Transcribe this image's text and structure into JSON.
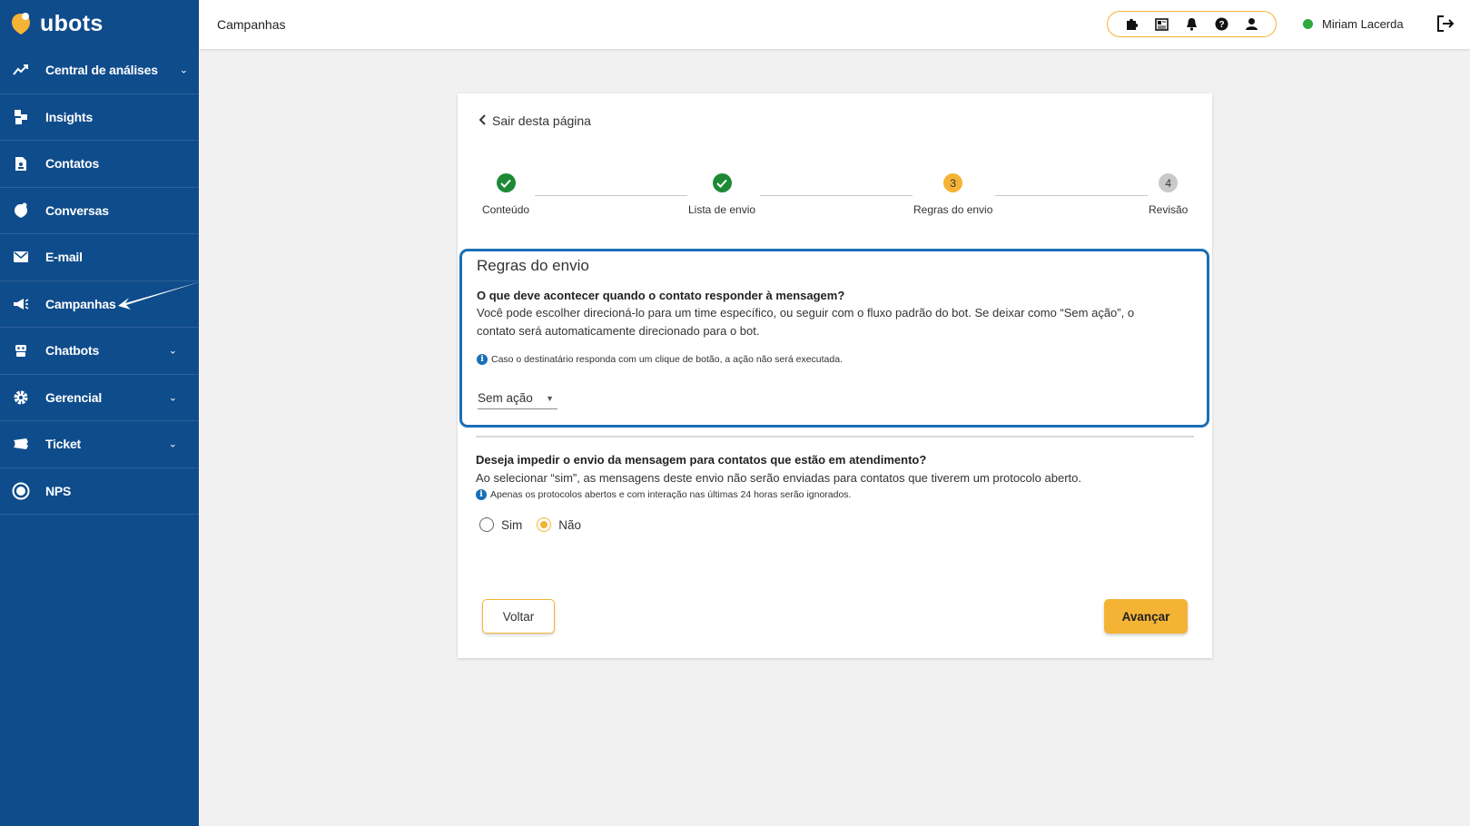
{
  "brand": {
    "name": "ubots",
    "accent": "#f5b335",
    "sidebar_bg": "#0f4c8c",
    "highlight": "#1a6fb5"
  },
  "sidebar": {
    "items": [
      {
        "label": "Central de análises",
        "icon": "chart-line-icon",
        "has_chevron": true
      },
      {
        "label": "Insights",
        "icon": "cubes-icon",
        "has_chevron": false
      },
      {
        "label": "Contatos",
        "icon": "contact-file-icon",
        "has_chevron": false
      },
      {
        "label": "Conversas",
        "icon": "chat-bubble-icon",
        "has_chevron": false
      },
      {
        "label": "E-mail",
        "icon": "envelope-icon",
        "has_chevron": false
      },
      {
        "label": "Campanhas",
        "icon": "megaphone-icon",
        "has_chevron": false
      },
      {
        "label": "Chatbots",
        "icon": "robot-icon",
        "has_chevron": true
      },
      {
        "label": "Gerencial",
        "icon": "gear-icon",
        "has_chevron": true
      },
      {
        "label": "Ticket",
        "icon": "ticket-icon",
        "has_chevron": true
      },
      {
        "label": "NPS",
        "icon": "nps-icon",
        "has_chevron": false
      }
    ]
  },
  "header": {
    "title": "Campanhas",
    "tools": [
      "puzzle-icon",
      "news-icon",
      "bell-icon",
      "help-icon",
      "user-icon"
    ],
    "user_name": "Miriam Lacerda",
    "status_color": "#2eaa3a"
  },
  "card": {
    "back_label": "Sair desta página",
    "steps": [
      {
        "label": "Conteúdo",
        "state": "done",
        "number": ""
      },
      {
        "label": "Lista de envio",
        "state": "done",
        "number": ""
      },
      {
        "label": "Regras do envio",
        "state": "active",
        "number": "3"
      },
      {
        "label": "Revisão",
        "state": "todo",
        "number": "4"
      }
    ],
    "rules": {
      "heading": "Regras do envio",
      "question": "O que deve acontecer quando o contato responder à mensagem?",
      "description_line1": "Você pode escolher direcioná-lo para um time específico, ou seguir com o fluxo padrão do bot. Se deixar como “Sem ação”, o",
      "description_line2": "contato será automaticamente direcionado para o bot.",
      "note": "Caso o destinatário responda com um clique de botão, a ação não será executada.",
      "select_value": "Sem ação"
    },
    "block": {
      "question": "Deseja impedir o envio da mensagem para contatos que estão em atendimento?",
      "description": "Ao selecionar “sim”, as mensagens deste envio não serão enviadas para contatos que tiverem um protocolo aberto.",
      "note": "Apenas os protocolos abertos e com interação nas últimas 24 horas serão ignorados.",
      "options": [
        {
          "label": "Sim",
          "checked": false
        },
        {
          "label": "Não",
          "checked": true
        }
      ]
    },
    "back_button": "Voltar",
    "next_button": "Avançar"
  }
}
